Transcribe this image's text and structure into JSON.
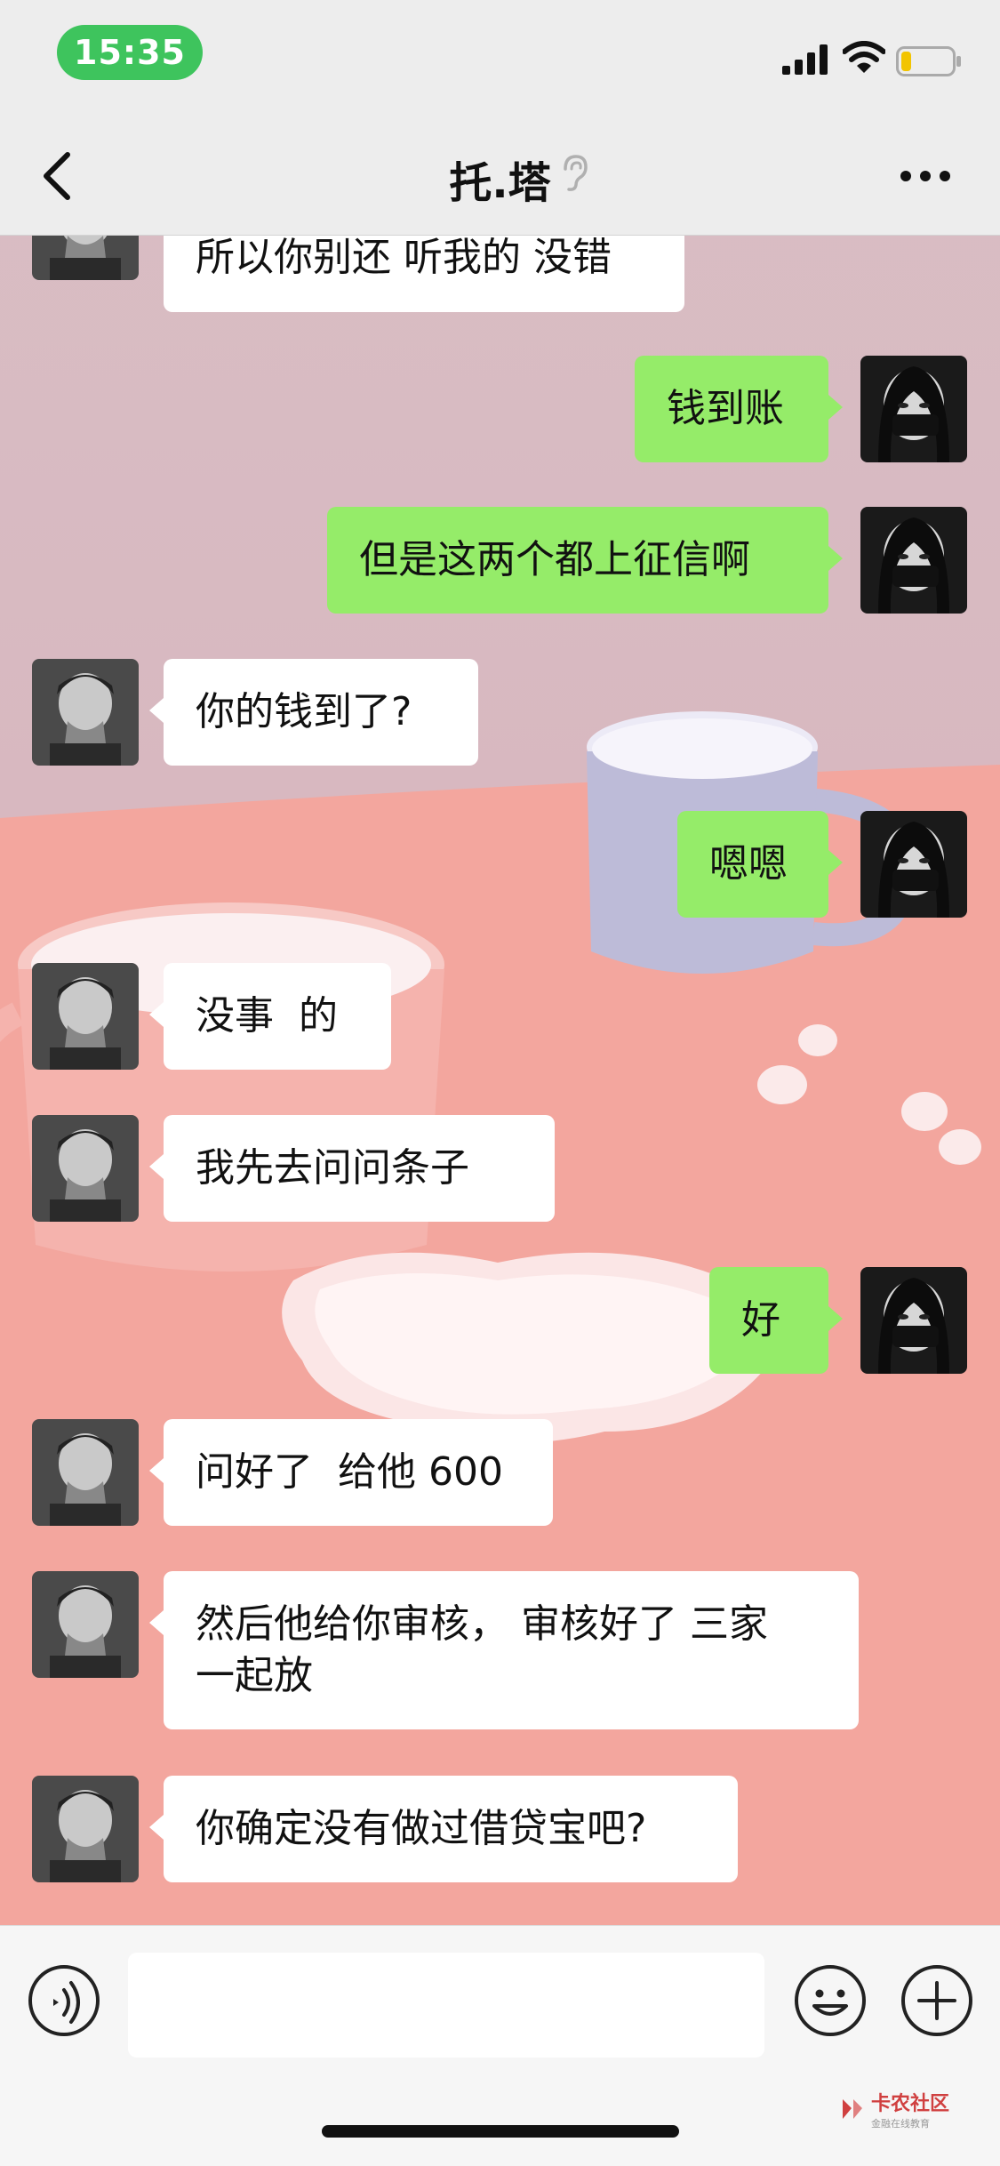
{
  "status_bar": {
    "time": "15:35",
    "battery_level": 0.2,
    "battery_color": "#f2c400",
    "time_pill_color": "#3ec45d"
  },
  "nav": {
    "title": "托.塔"
  },
  "messages": [
    {
      "side": "in",
      "text": "所以你别还 听我的 没错"
    },
    {
      "side": "out",
      "text": "钱到账"
    },
    {
      "side": "out",
      "text": "但是这两个都上征信啊"
    },
    {
      "side": "in",
      "text": "你的钱到了?"
    },
    {
      "side": "out",
      "text": "嗯嗯"
    },
    {
      "side": "in",
      "text": "没事  的"
    },
    {
      "side": "in",
      "text": "我先去问问条子"
    },
    {
      "side": "out",
      "text": "好"
    },
    {
      "side": "in",
      "text": "问好了  给他 600"
    },
    {
      "side": "in",
      "text": "然后他给你审核， 审核好了 三家\n一起放"
    },
    {
      "side": "in",
      "text": "你确定没有做过借贷宝吧?"
    }
  ],
  "input_bar": {
    "value": "",
    "placeholder": ""
  },
  "watermark": {
    "text": "卡农社区",
    "sub": "金融在线教育"
  },
  "colors": {
    "outgoing_bubble": "#95ec69",
    "incoming_bubble": "#ffffff",
    "bar_bg": "#ededed"
  }
}
